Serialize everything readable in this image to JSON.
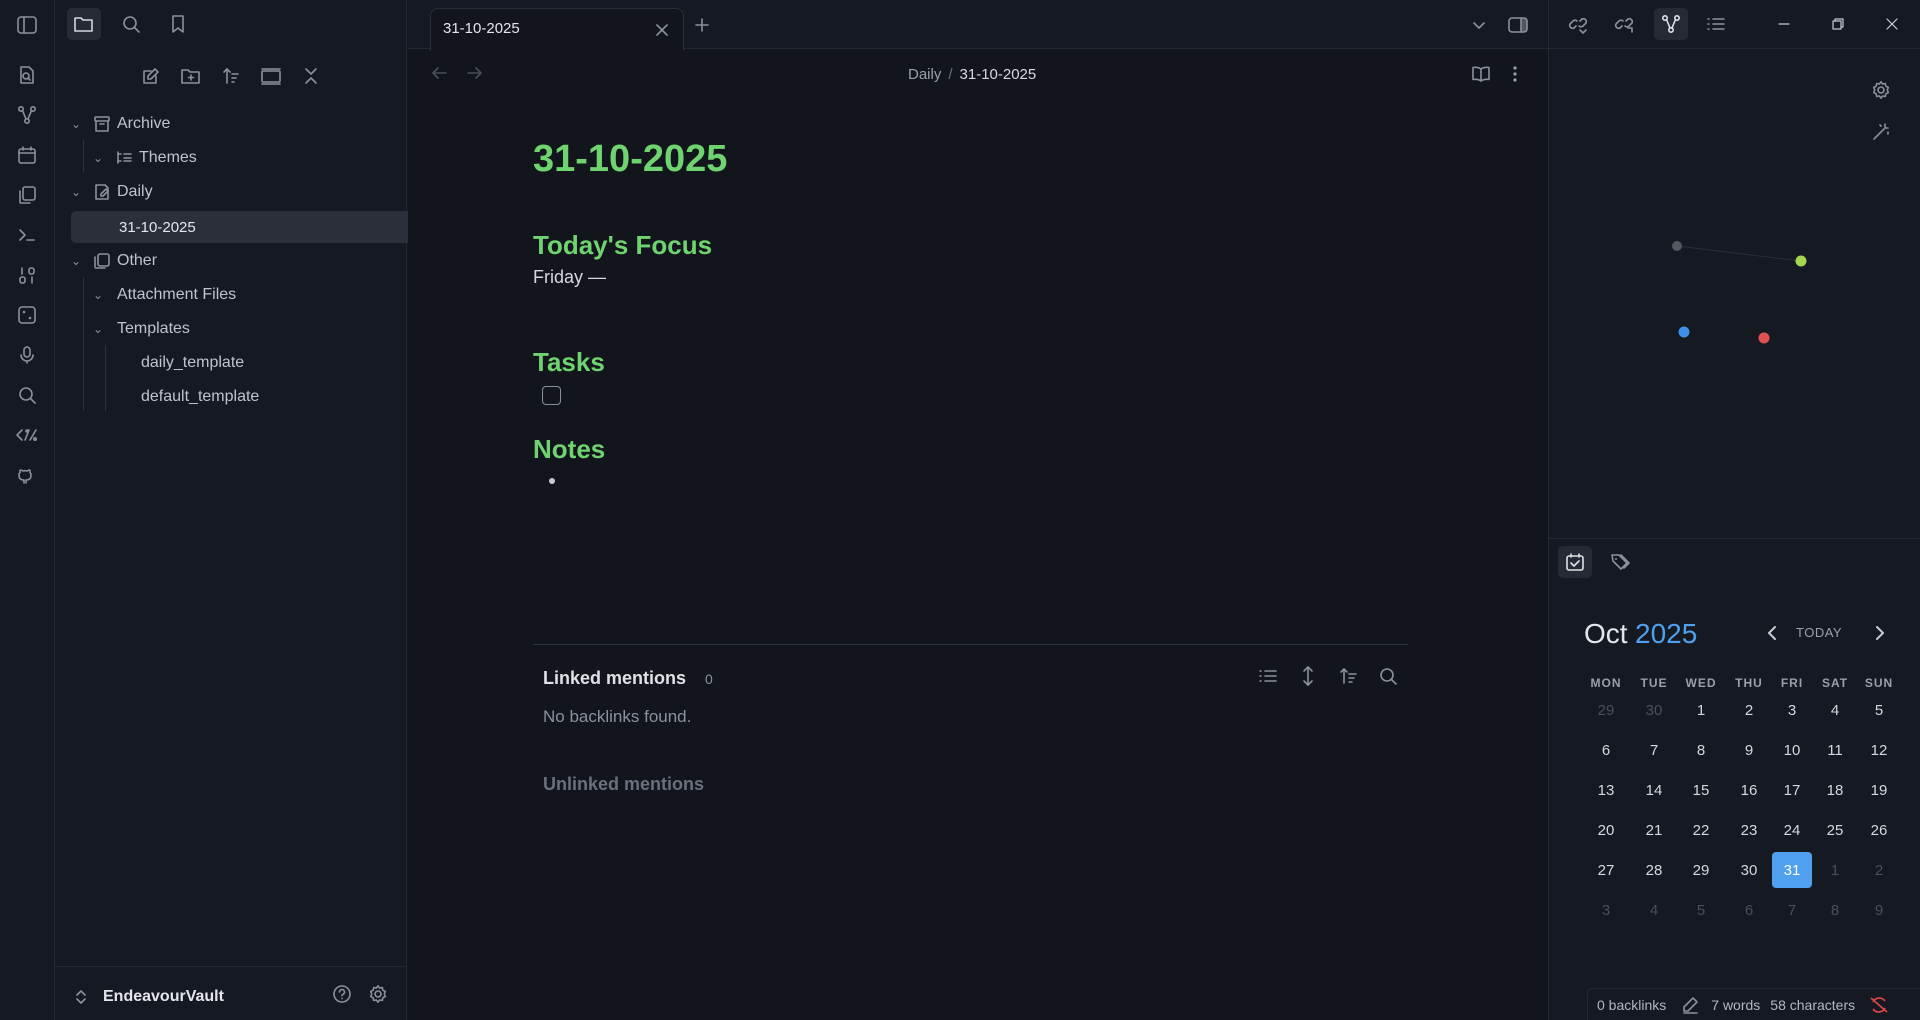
{
  "tab": {
    "title": "31-10-2025"
  },
  "breadcrumb": {
    "parent": "Daily",
    "separator": "/",
    "current": "31-10-2025"
  },
  "vault": {
    "name": "EndeavourVault"
  },
  "tree": {
    "archive": "Archive",
    "themes": "Themes",
    "daily": "Daily",
    "daily_note": "31-10-2025",
    "other": "Other",
    "attachments": "Attachment Files",
    "templates": "Templates",
    "daily_template": "daily_template",
    "default_template": "default_template"
  },
  "note": {
    "title": "31-10-2025",
    "h_focus": "Today's Focus",
    "focus_text": "Friday —",
    "h_tasks": "Tasks",
    "h_notes": "Notes"
  },
  "backlinks": {
    "linked_title": "Linked mentions",
    "linked_count": "0",
    "empty": "No backlinks found.",
    "unlinked_title": "Unlinked mentions"
  },
  "calendar": {
    "month": "Oct",
    "year": "2025",
    "today_label": "TODAY",
    "weekdays": [
      "MON",
      "TUE",
      "WED",
      "THU",
      "FRI",
      "SAT",
      "SUN"
    ],
    "weeks": [
      [
        "29",
        "30",
        "1",
        "2",
        "3",
        "4",
        "5"
      ],
      [
        "6",
        "7",
        "8",
        "9",
        "10",
        "11",
        "12"
      ],
      [
        "13",
        "14",
        "15",
        "16",
        "17",
        "18",
        "19"
      ],
      [
        "20",
        "21",
        "22",
        "23",
        "24",
        "25",
        "26"
      ],
      [
        "27",
        "28",
        "29",
        "30",
        "31",
        "1",
        "2"
      ],
      [
        "3",
        "4",
        "5",
        "6",
        "7",
        "8",
        "9"
      ]
    ],
    "selected_day": "31",
    "accent": "#4fa0ef"
  },
  "status": {
    "backlinks": "0 backlinks",
    "words": "7 words",
    "characters": "58 characters"
  },
  "colors": {
    "heading": "#6fd36f",
    "selected_row": "#2a2f3a",
    "graph_nodes": [
      "#55595f",
      "#a5d64f",
      "#3f8fe8",
      "#e05252"
    ]
  }
}
